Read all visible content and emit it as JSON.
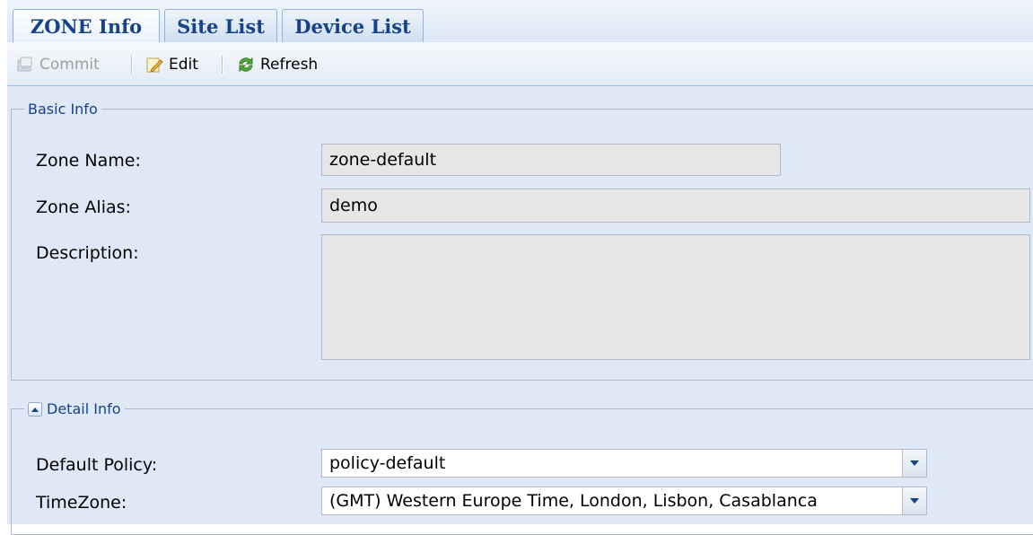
{
  "tabs": [
    {
      "label": "ZONE Info",
      "active": true
    },
    {
      "label": "Site List",
      "active": false
    },
    {
      "label": "Device List",
      "active": false
    }
  ],
  "toolbar": {
    "commit_label": "Commit",
    "edit_label": "Edit",
    "refresh_label": "Refresh"
  },
  "basic_info": {
    "legend": "Basic Info",
    "zone_name_label": "Zone Name:",
    "zone_name_value": "zone-default",
    "zone_alias_label": "Zone Alias:",
    "zone_alias_value": "demo",
    "description_label": "Description:",
    "description_value": ""
  },
  "detail_info": {
    "legend": "Detail Info",
    "default_policy_label": "Default Policy:",
    "default_policy_value": "policy-default",
    "timezone_label": "TimeZone:",
    "timezone_value": "(GMT) Western Europe Time, London, Lisbon, Casablanca"
  },
  "colors": {
    "accent": "#15428b",
    "panel_bg": "#dfe8f6",
    "field_bg": "#e6e6e6"
  }
}
